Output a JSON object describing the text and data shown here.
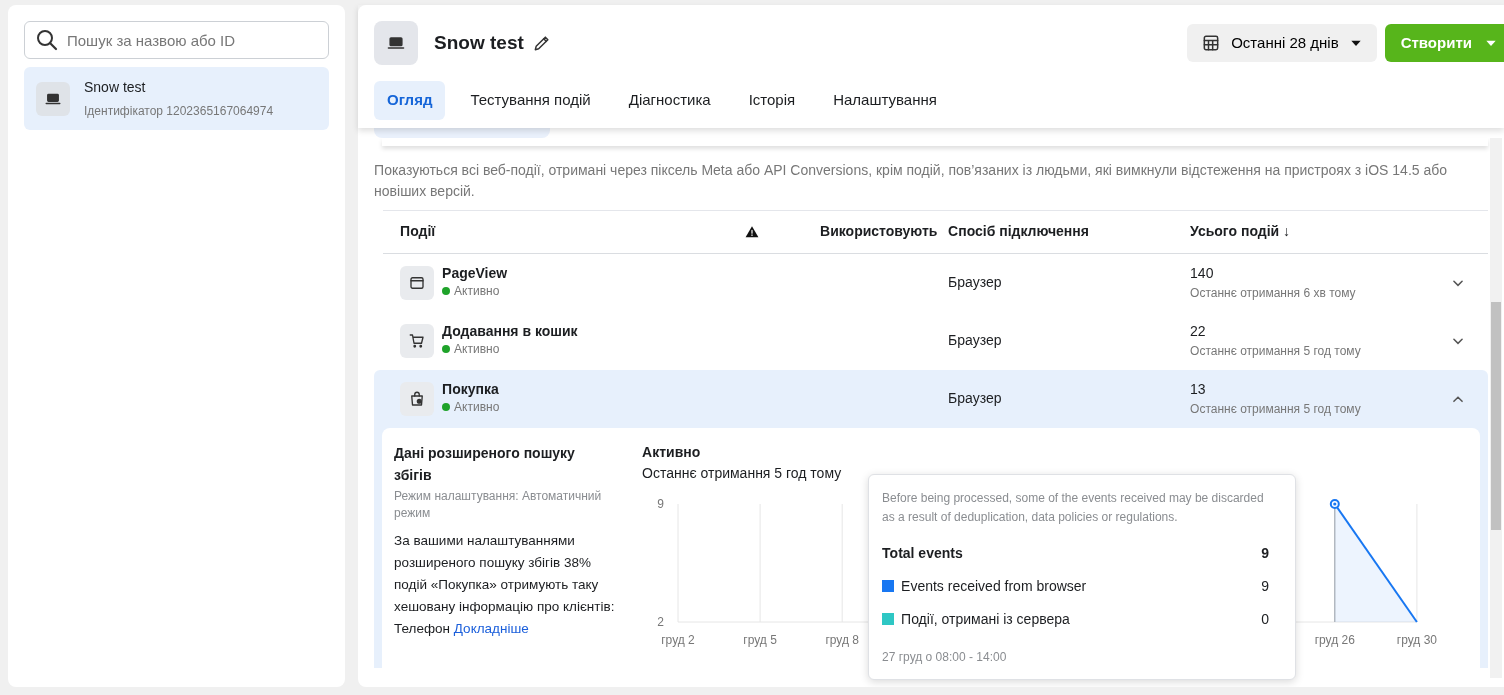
{
  "sidebar": {
    "search": {
      "placeholder": "Пошук за назвою або ID"
    },
    "items": [
      {
        "name": "Snow test",
        "id_text": "Ідентифікатор 1202365167064974",
        "selected": true
      }
    ]
  },
  "header": {
    "title": "Snow test",
    "date_range": "Останні 28 днів",
    "create_button": "Створити"
  },
  "tabs": [
    {
      "label": "Огляд",
      "selected": true
    },
    {
      "label": "Тестування подій",
      "selected": false
    },
    {
      "label": "Діагностика",
      "selected": false
    },
    {
      "label": "Історія",
      "selected": false
    },
    {
      "label": "Налаштування",
      "selected": false
    }
  ],
  "description": "Показуються всі веб-події, отримані через піксель Meta або API Conversions, крім подій, пов’язаних із людьми, які вимкнули відстеження на пристроях з iOS 14.5 або новіших версій.",
  "table": {
    "columns": [
      {
        "kind": "text",
        "label": "Події"
      },
      {
        "kind": "warning"
      },
      {
        "kind": "text",
        "label": "Використовують"
      },
      {
        "kind": "text",
        "label": "Спосіб підключення"
      },
      {
        "kind": "text",
        "label": "Усього подій ↓"
      }
    ],
    "rows": [
      {
        "kind": "page",
        "name": "PageView",
        "status": "Активно",
        "active": true,
        "method": "Браузер",
        "total": "140",
        "last_received": "Останнє отримання 6 хв тому",
        "expanded": false
      },
      {
        "kind": "cart",
        "name": "Додавання в кошик",
        "status": "Активно",
        "active": true,
        "method": "Браузер",
        "total": "22",
        "last_received": "Останнє отримання 5 год тому",
        "expanded": false
      },
      {
        "kind": "bag",
        "name": "Покупка",
        "status": "Активно",
        "active": true,
        "method": "Браузер",
        "total": "13",
        "last_received": "Останнє отримання 5 год тому",
        "expanded": true
      }
    ]
  },
  "details": {
    "title": "Дані розширеного пошуку збігів",
    "mode": "Режим налаштування: Автоматичний режим",
    "body": "За вашими налаштуваннями розширеного пошуку збігів 38% подій «Покупка» отримують таку хешовану інформацію про клієнтів: Телефон",
    "link": "Докладніше",
    "status": "Активно",
    "last_received": "Останнє отримання 5 год тому",
    "chart_data": {
      "type": "area",
      "categories": [
        "груд 2",
        "груд 5",
        "груд 8",
        null,
        null,
        null,
        null,
        null,
        "груд 26",
        "груд 30"
      ],
      "series": [
        {
          "color": "#1877f2",
          "values": [
            null,
            null,
            null,
            null,
            null,
            null,
            null,
            null,
            9,
            2
          ]
        }
      ],
      "ylim": [
        2,
        9
      ],
      "yticks": [
        2,
        9
      ],
      "grid": true
    },
    "tooltip": {
      "note": "Before being processed, some of the events received may be discarded as a result of deduplication, data policies or regulations.",
      "total_label": "Total events",
      "total": "9",
      "rows": [
        {
          "label": "Events received from browser",
          "value": "9",
          "color": "#1877f2"
        },
        {
          "label": "Події, отримані із сервера",
          "value": "0",
          "color": "#2ec7c4"
        }
      ],
      "footer": "27 груд о 08:00 - 14:00"
    }
  }
}
